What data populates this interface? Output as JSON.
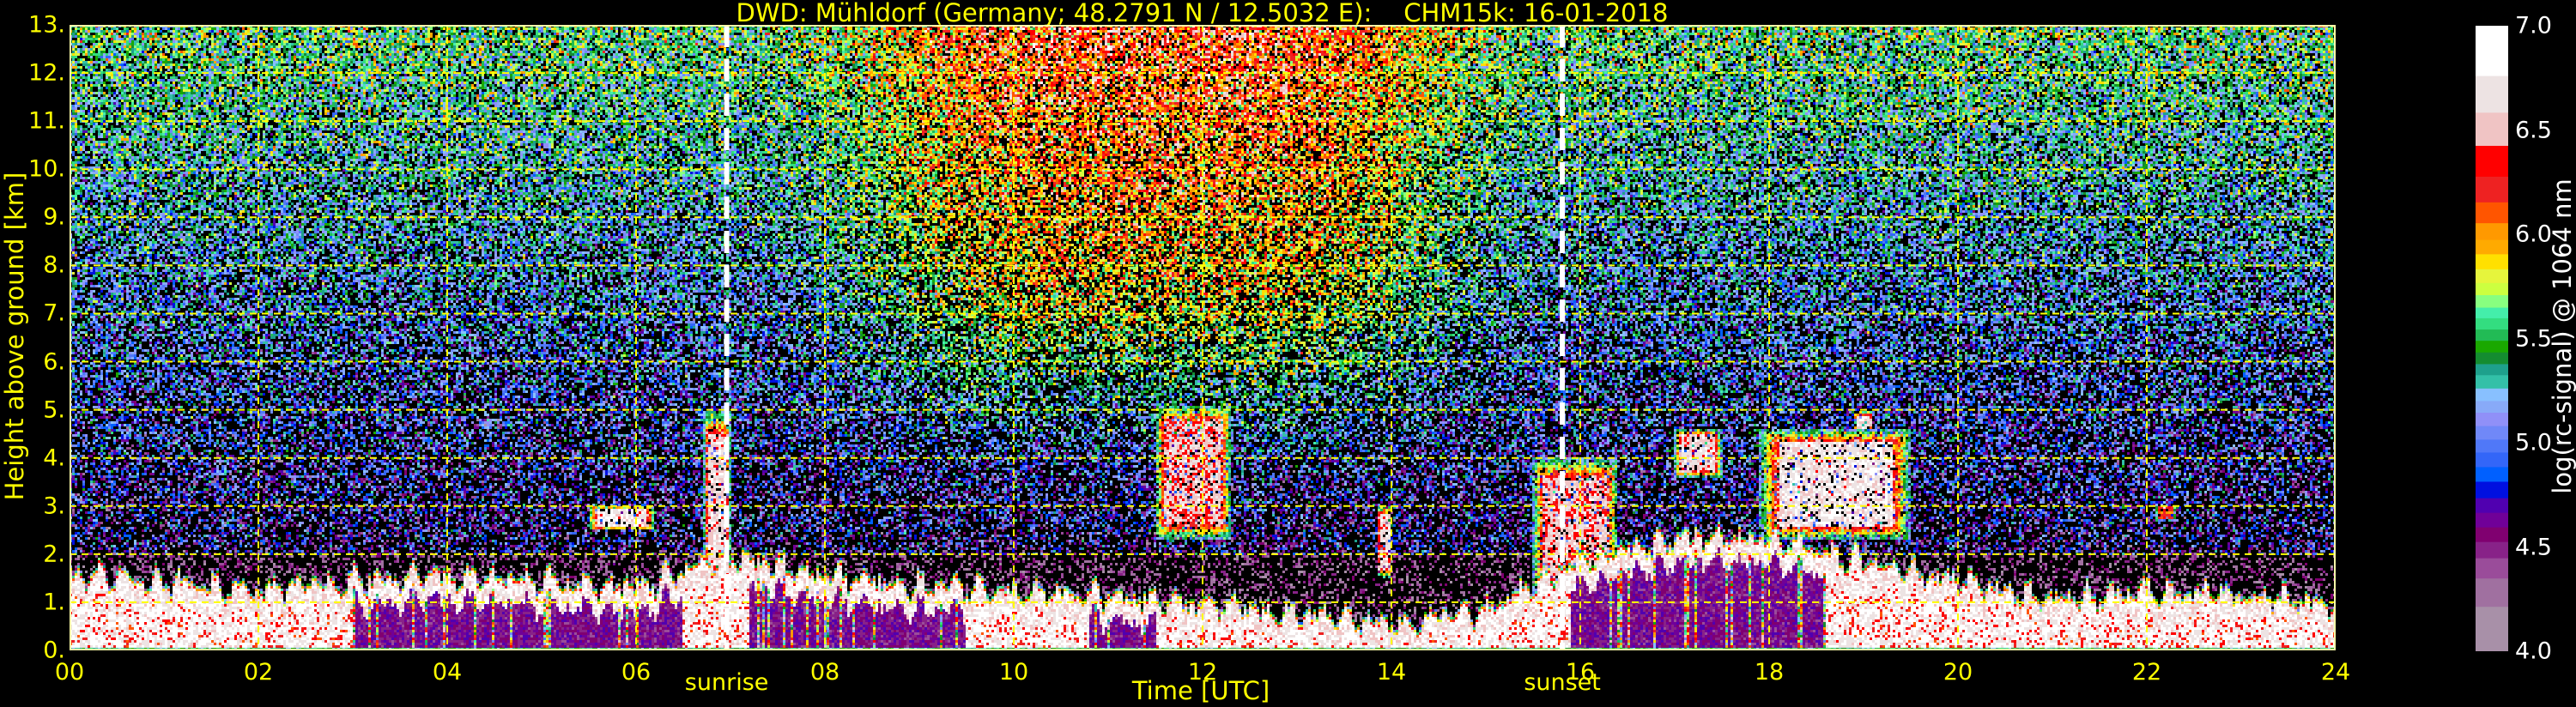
{
  "chart_data": {
    "type": "heatmap",
    "title": "DWD: Mühldorf (Germany; 48.2791 N / 12.5032 E):    CHM15k: 16-01-2018",
    "xlabel": "Time [UTC]",
    "ylabel": "Height above ground [km]",
    "xlim": [
      0,
      24
    ],
    "ylim": [
      0,
      13
    ],
    "grid": true,
    "grid_color": "#ffff00",
    "xticks": [
      {
        "value": 0,
        "label": "00"
      },
      {
        "value": 2,
        "label": "02"
      },
      {
        "value": 4,
        "label": "04"
      },
      {
        "value": 6,
        "label": "06"
      },
      {
        "value": 8,
        "label": "08"
      },
      {
        "value": 10,
        "label": "10"
      },
      {
        "value": 12,
        "label": "12"
      },
      {
        "value": 14,
        "label": "14"
      },
      {
        "value": 16,
        "label": "16"
      },
      {
        "value": 18,
        "label": "18"
      },
      {
        "value": 20,
        "label": "20"
      },
      {
        "value": 22,
        "label": "22"
      },
      {
        "value": 24,
        "label": "24"
      }
    ],
    "yticks": [
      {
        "value": 0,
        "label": "0."
      },
      {
        "value": 1,
        "label": "1."
      },
      {
        "value": 2,
        "label": "2."
      },
      {
        "value": 3,
        "label": "3."
      },
      {
        "value": 4,
        "label": "4."
      },
      {
        "value": 5,
        "label": "5."
      },
      {
        "value": 6,
        "label": "6."
      },
      {
        "value": 7,
        "label": "7."
      },
      {
        "value": 8,
        "label": "8."
      },
      {
        "value": 9,
        "label": "9."
      },
      {
        "value": 10,
        "label": "10."
      },
      {
        "value": 11,
        "label": "11."
      },
      {
        "value": 12,
        "label": "12."
      },
      {
        "value": 13,
        "label": "13."
      }
    ],
    "annotations": [
      {
        "label": "sunrise",
        "time": 6.96
      },
      {
        "label": "sunset",
        "time": 15.81
      }
    ],
    "colorbar": {
      "label": "log(rc-signal) @ 1064 nm",
      "range": [
        4.0,
        7.0
      ],
      "ticks": [
        {
          "value": 4.0,
          "label": "4.0"
        },
        {
          "value": 4.5,
          "label": "4.5"
        },
        {
          "value": 5.0,
          "label": "5.0"
        },
        {
          "value": 5.5,
          "label": "5.5"
        },
        {
          "value": 6.0,
          "label": "6.0"
        },
        {
          "value": 6.5,
          "label": "6.5"
        },
        {
          "value": 7.0,
          "label": "7.0"
        }
      ],
      "levels": [
        {
          "from": 4.0,
          "color": "#a890a8"
        },
        {
          "from": 4.215,
          "color": "#a070a0"
        },
        {
          "from": 4.351,
          "color": "#9a4c9a"
        },
        {
          "from": 4.448,
          "color": "#882288"
        },
        {
          "from": 4.526,
          "color": "#800070"
        },
        {
          "from": 4.596,
          "color": "#700098"
        },
        {
          "from": 4.666,
          "color": "#5000b0"
        },
        {
          "from": 4.736,
          "color": "#0010e0"
        },
        {
          "from": 4.815,
          "color": "#0060ff"
        },
        {
          "from": 4.885,
          "color": "#3366f8"
        },
        {
          "from": 4.955,
          "color": "#5078f8"
        },
        {
          "from": 5.017,
          "color": "#7088f8"
        },
        {
          "from": 5.082,
          "color": "#9090f8"
        },
        {
          "from": 5.146,
          "color": "#88aaf8"
        },
        {
          "from": 5.202,
          "color": "#88c0ff"
        },
        {
          "from": 5.262,
          "color": "#33c0a8"
        },
        {
          "from": 5.326,
          "color": "#1ea08c"
        },
        {
          "from": 5.379,
          "color": "#148c30"
        },
        {
          "from": 5.435,
          "color": "#1aa800"
        },
        {
          "from": 5.491,
          "color": "#22bb55"
        },
        {
          "from": 5.545,
          "color": "#33dd80"
        },
        {
          "from": 5.599,
          "color": "#44eeaa"
        },
        {
          "from": 5.65,
          "color": "#88ff80"
        },
        {
          "from": 5.71,
          "color": "#ccff40"
        },
        {
          "from": 5.768,
          "color": "#e6f53c"
        },
        {
          "from": 5.834,
          "color": "#ffe000"
        },
        {
          "from": 5.906,
          "color": "#ffaa00"
        },
        {
          "from": 5.975,
          "color": "#ff9900"
        },
        {
          "from": 6.055,
          "color": "#ff5500"
        },
        {
          "from": 6.155,
          "color": "#ee2222"
        },
        {
          "from": 6.278,
          "color": "#ff0000"
        },
        {
          "from": 6.426,
          "color": "#f0c4c4"
        },
        {
          "from": 6.585,
          "color": "#ede3e3"
        },
        {
          "from": 6.761,
          "color": "#ffffff"
        }
      ]
    },
    "boundary_layer": {
      "hours": [
        0,
        1,
        2,
        3,
        4,
        5,
        6,
        7,
        8,
        9,
        10,
        11,
        12,
        13,
        14,
        15,
        16,
        17,
        18,
        19,
        20,
        21,
        22,
        23,
        24
      ],
      "top_km": [
        1.6,
        1.5,
        1.3,
        1.5,
        1.6,
        1.5,
        1.4,
        2.0,
        1.6,
        1.4,
        1.3,
        1.2,
        1.0,
        0.8,
        0.6,
        0.9,
        1.9,
        2.4,
        2.4,
        1.9,
        1.5,
        1.1,
        1.3,
        1.2,
        1.0
      ]
    },
    "low_aerosol_periods": [
      [
        3.0,
        6.5
      ],
      [
        7.2,
        9.5
      ],
      [
        10.8,
        11.5
      ],
      [
        15.9,
        18.6
      ]
    ],
    "cloud_features": [
      {
        "t": [
          5.5,
          6.2
        ],
        "h": [
          2.5,
          3.0
        ],
        "value": 6.7
      },
      {
        "t": [
          6.72,
          7.0
        ],
        "h": [
          0.3,
          5.0
        ],
        "value": 6.6
      },
      {
        "t": [
          11.5,
          12.3
        ],
        "h": [
          2.3,
          5.1
        ],
        "value": 6.5
      },
      {
        "t": [
          13.85,
          14.0
        ],
        "h": [
          1.5,
          3.0
        ],
        "value": 6.6
      },
      {
        "t": [
          15.5,
          16.4
        ],
        "h": [
          0.5,
          4.0
        ],
        "value": 6.5
      },
      {
        "t": [
          17.0,
          17.5
        ],
        "h": [
          3.6,
          4.6
        ],
        "value": 6.6
      },
      {
        "t": [
          17.9,
          19.5
        ],
        "h": [
          2.3,
          4.6
        ],
        "value": 6.7
      },
      {
        "t": [
          18.9,
          19.1
        ],
        "h": [
          4.0,
          5.0
        ],
        "value": 6.7
      },
      {
        "t": [
          22.1,
          22.3
        ],
        "h": [
          2.7,
          3.0
        ],
        "value": 6.2
      }
    ],
    "daylight_background_period": [
      8.5,
      14.5
    ]
  }
}
